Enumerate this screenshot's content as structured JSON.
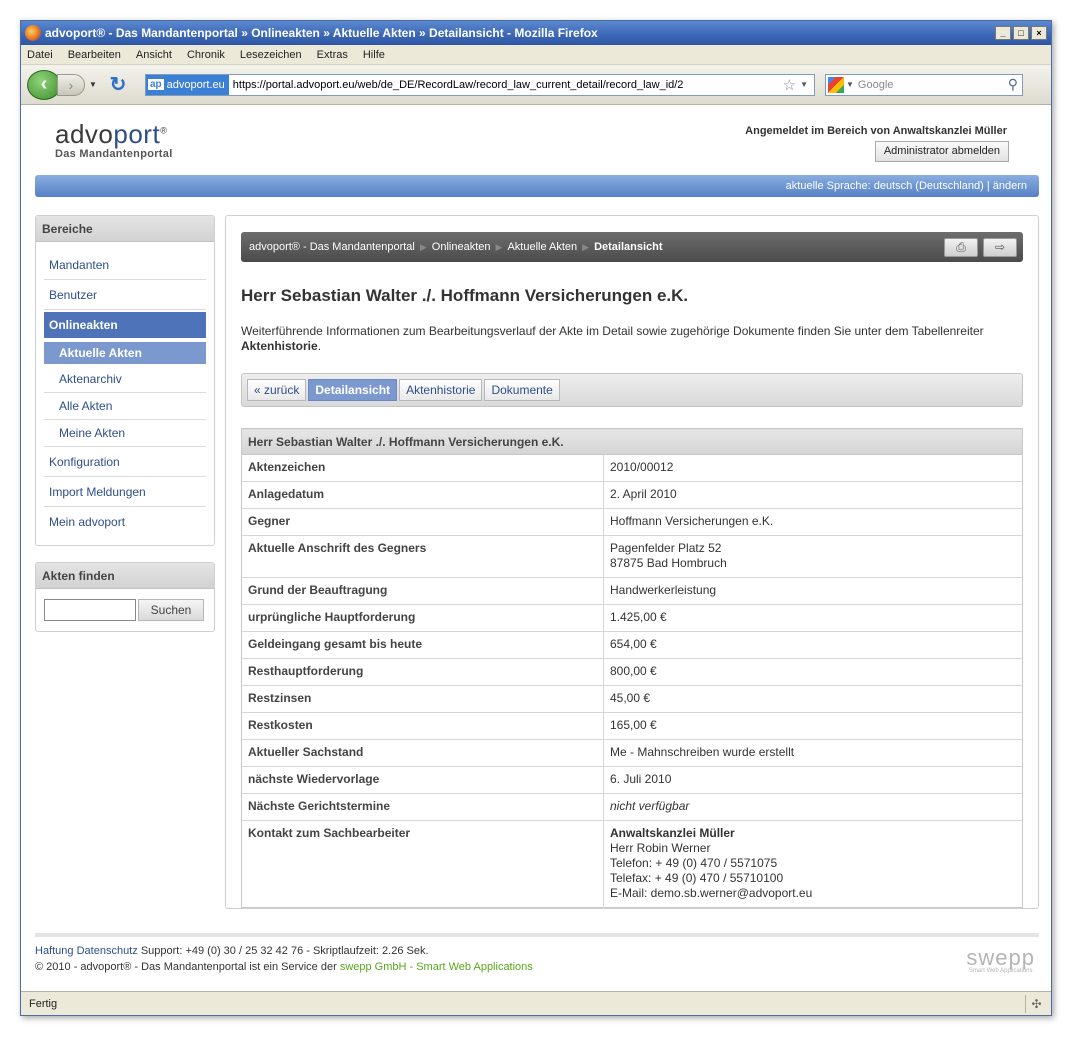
{
  "window": {
    "title": "advoport® - Das Mandantenportal  »  Onlineakten  »  Aktuelle Akten  »  Detailansicht - Mozilla Firefox",
    "min": "_",
    "max": "□",
    "close": "×"
  },
  "menu": [
    "Datei",
    "Bearbeiten",
    "Ansicht",
    "Chronik",
    "Lesezeichen",
    "Extras",
    "Hilfe"
  ],
  "nav": {
    "site_badge": "ap",
    "site_name": "advoport.eu",
    "url": "https://portal.advoport.eu/web/de_DE/RecordLaw/record_law_current_detail/record_law_id/2",
    "search_placeholder": "Google"
  },
  "header": {
    "logo_advo": "advo",
    "logo_port": "port",
    "logo_reg": "®",
    "logo_tagline": "Das Mandantenportal",
    "login_text": "Angemeldet im Bereich von Anwaltskanzlei Müller",
    "logout_label": "Administrator abmelden",
    "language_text": "aktuelle Sprache: deutsch (Deutschland) | ändern"
  },
  "sidebar": {
    "title": "Bereiche",
    "items": [
      {
        "label": "Mandanten"
      },
      {
        "label": "Benutzer"
      },
      {
        "label": "Onlineakten"
      },
      {
        "label": "Aktuelle Akten"
      },
      {
        "label": "Aktenarchiv"
      },
      {
        "label": "Alle Akten"
      },
      {
        "label": "Meine Akten"
      },
      {
        "label": "Konfiguration"
      },
      {
        "label": "Import Meldungen"
      },
      {
        "label": "Mein advoport"
      }
    ],
    "search_title": "Akten finden",
    "search_button": "Suchen"
  },
  "breadcrumb": [
    "advoport® - Das Mandantenportal",
    "Onlineakten",
    "Aktuelle Akten",
    "Detailansicht"
  ],
  "page": {
    "title": "Herr Sebastian Walter ./. Hoffmann Versicherungen e.K.",
    "intro_text": "Weiterführende Informationen zum Bearbeitungsverlauf der Akte im Detail sowie zugehörige Dokumente finden Sie unter dem Tabellenreiter ",
    "intro_bold": "Aktenhistorie",
    "intro_end": "."
  },
  "tabs": [
    "« zurück",
    "Detailansicht",
    "Aktenhistorie",
    "Dokumente"
  ],
  "table": {
    "header": "Herr Sebastian Walter ./. Hoffmann Versicherungen e.K.",
    "rows": [
      {
        "label": "Aktenzeichen",
        "value": "2010/00012"
      },
      {
        "label": "Anlagedatum",
        "value": "2. April 2010"
      },
      {
        "label": "Gegner",
        "value": "Hoffmann Versicherungen e.K."
      },
      {
        "label": "Aktuelle Anschrift des Gegners",
        "value": "Pagenfelder Platz 52",
        "value2": "87875 Bad Hombruch"
      },
      {
        "label": "Grund der Beauftragung",
        "value": "Handwerkerleistung"
      },
      {
        "label": "urprüngliche Hauptforderung",
        "value": "1.425,00 €"
      },
      {
        "label": "Geldeingang gesamt bis heute",
        "value": "654,00 €"
      },
      {
        "label": "Resthauptforderung",
        "value": "800,00 €"
      },
      {
        "label": "Restzinsen",
        "value": "45,00 €"
      },
      {
        "label": "Restkosten",
        "value": "165,00 €"
      },
      {
        "label": "Aktueller Sachstand",
        "value": "Me - Mahnschreiben wurde erstellt"
      },
      {
        "label": "nächste Wiedervorlage",
        "value": "6. Juli 2010"
      },
      {
        "label": "Nächste Gerichtstermine",
        "value": "nicht verfügbar"
      },
      {
        "label": "Kontakt zum Sachbearbeiter",
        "contact_name": "Anwaltskanzlei Müller",
        "contact_person": "Herr Robin Werner",
        "contact_phone": "Telefon: + 49 (0) 470 / 5571075",
        "contact_fax": "Telefax: + 49 (0) 470 / 55710100",
        "contact_email": "E-Mail: demo.sb.werner@advoport.eu"
      }
    ]
  },
  "footer": {
    "link_haftung": "Haftung",
    "link_datenschutz": "Datenschutz",
    "support": "Support: +49 (0) 30 / 25 32 42 76 - Skriptlaufzeit: 2.26 Sek.",
    "copyright": "© 2010 - advoport® - Das Mandantenportal ist ein Service der ",
    "company": "swepp GmbH - Smart Web Applications",
    "brand": "swepp",
    "brand_sub": "Smart Web Applications"
  },
  "status": {
    "text": "Fertig"
  }
}
